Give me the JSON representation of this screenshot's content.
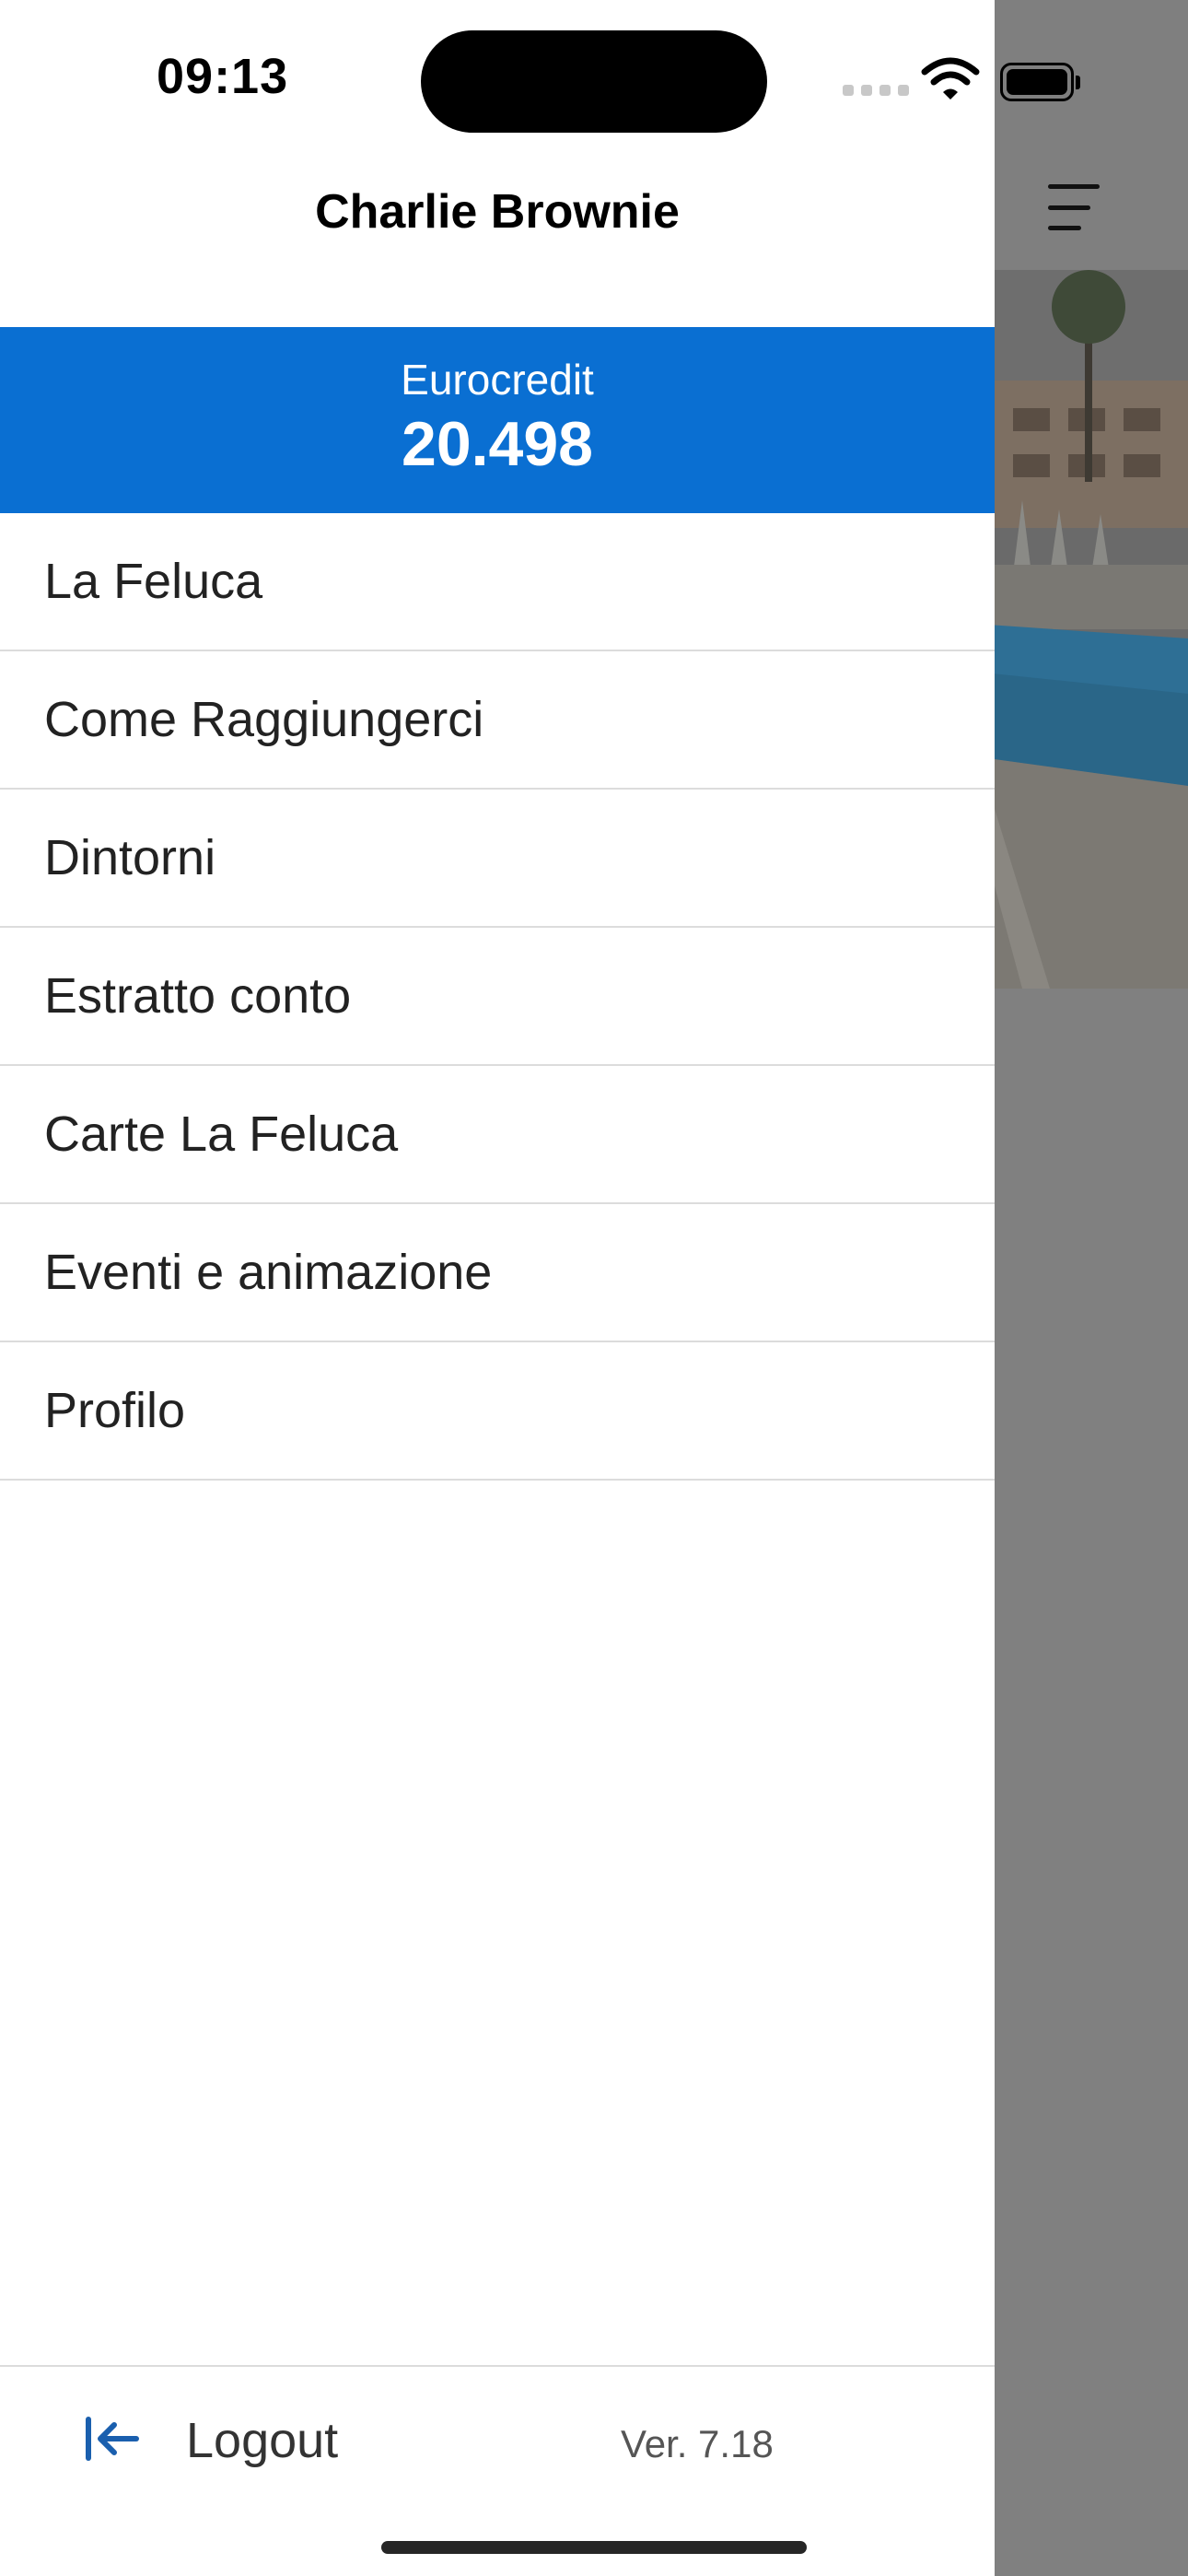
{
  "status_bar": {
    "time": "09:13"
  },
  "header": {
    "user_name": "Charlie Brownie"
  },
  "credit": {
    "label": "Eurocredit",
    "value": "20.498"
  },
  "menu": {
    "items": [
      {
        "label": "La Feluca"
      },
      {
        "label": "Come Raggiungerci"
      },
      {
        "label": "Dintorni"
      },
      {
        "label": "Estratto conto"
      },
      {
        "label": "Carte La Feluca"
      },
      {
        "label": "Eventi e animazione"
      },
      {
        "label": "Profilo"
      }
    ]
  },
  "footer": {
    "logout_label": "Logout",
    "version": "Ver. 7.18"
  },
  "colors": {
    "accent": "#0a6fd2",
    "overlay": "#808080",
    "logout_icon": "#1a5fae"
  },
  "icons": [
    "wifi-icon",
    "battery-icon",
    "menu-icon",
    "logout-icon"
  ]
}
